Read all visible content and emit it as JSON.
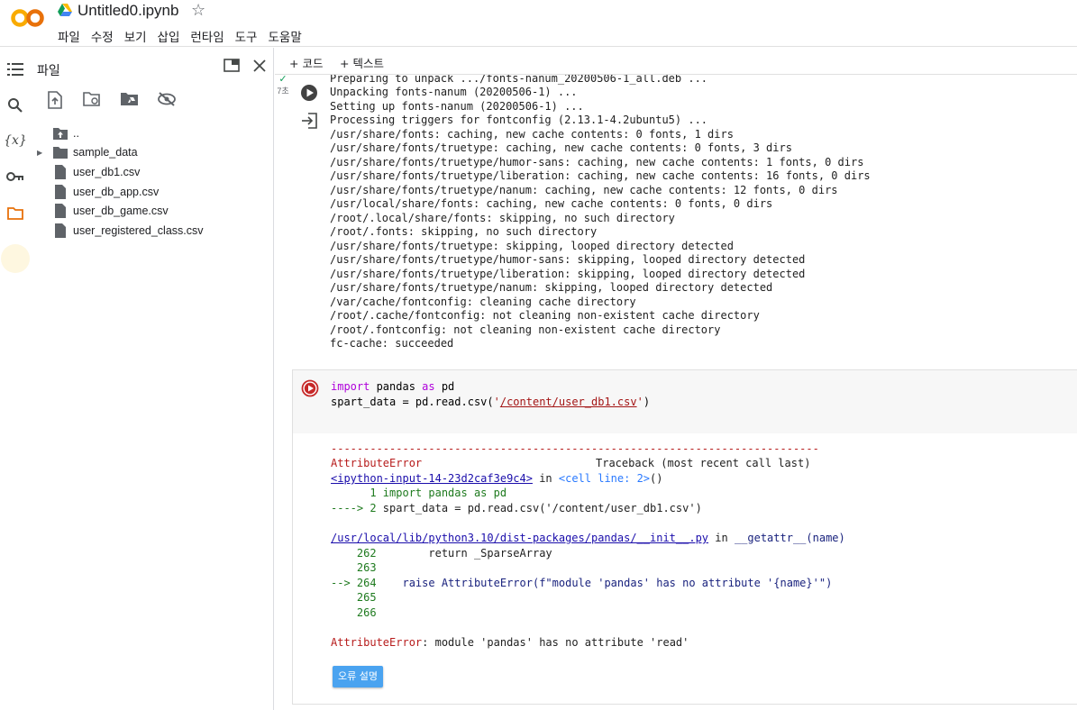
{
  "header": {
    "title": "Untitled0.ipynb",
    "menu": [
      "파일",
      "수정",
      "보기",
      "삽입",
      "런타임",
      "도구",
      "도움말"
    ]
  },
  "colors": {
    "logo_orange": "#f9ab00",
    "logo_dark_orange": "#e8710a",
    "run_red": "#c62828",
    "button_blue": "#4aa3f0"
  },
  "sidebar": {
    "rail_icons": [
      "table-of-contents-icon",
      "search-icon",
      "variables-icon",
      "secrets-key-icon",
      "folder-icon"
    ],
    "panel_title": "파일",
    "toolbar_icons": [
      "upload-file-icon",
      "refresh-icon",
      "mount-drive-icon",
      "hide-files-icon"
    ],
    "tree": [
      {
        "label": "..",
        "type": "parent-folder"
      },
      {
        "label": "sample_data",
        "type": "folder"
      },
      {
        "label": "user_db1.csv",
        "type": "file"
      },
      {
        "label": "user_db_app.csv",
        "type": "file"
      },
      {
        "label": "user_db_game.csv",
        "type": "file"
      },
      {
        "label": "user_registered_class.csv",
        "type": "file"
      }
    ]
  },
  "toolbar": {
    "add_code": "+ 코드",
    "add_text": "+ 텍스트"
  },
  "cell1": {
    "status": "7초",
    "output": [
      "Preparing to unpack .../fonts-nanum_20200506-1_all.deb ...",
      "Unpacking fonts-nanum (20200506-1) ...",
      "Setting up fonts-nanum (20200506-1) ...",
      "Processing triggers for fontconfig (2.13.1-4.2ubuntu5) ...",
      "/usr/share/fonts: caching, new cache contents: 0 fonts, 1 dirs",
      "/usr/share/fonts/truetype: caching, new cache contents: 0 fonts, 3 dirs",
      "/usr/share/fonts/truetype/humor-sans: caching, new cache contents: 1 fonts, 0 dirs",
      "/usr/share/fonts/truetype/liberation: caching, new cache contents: 16 fonts, 0 dirs",
      "/usr/share/fonts/truetype/nanum: caching, new cache contents: 12 fonts, 0 dirs",
      "/usr/local/share/fonts: caching, new cache contents: 0 fonts, 0 dirs",
      "/root/.local/share/fonts: skipping, no such directory",
      "/root/.fonts: skipping, no such directory",
      "/usr/share/fonts/truetype: skipping, looped directory detected",
      "/usr/share/fonts/truetype/humor-sans: skipping, looped directory detected",
      "/usr/share/fonts/truetype/liberation: skipping, looped directory detected",
      "/usr/share/fonts/truetype/nanum: skipping, looped directory detected",
      "/var/cache/fontconfig: cleaning cache directory",
      "/root/.cache/fontconfig: not cleaning non-existent cache directory",
      "/root/.fontconfig: not cleaning non-existent cache directory",
      "fc-cache: succeeded"
    ]
  },
  "cell2": {
    "code": {
      "l1_kw1": "import",
      "l1_mod": " pandas ",
      "l1_kw2": "as",
      "l1_alias": " pd",
      "l2_pre": "spart_data = pd.read.csv(",
      "l2_q1": "'",
      "l2_path": "/content/user_db1.csv",
      "l2_q2": "'",
      "l2_post": ")"
    },
    "error": {
      "dashes": "---------------------------------------------------------------------------",
      "type": "AttributeError",
      "traceback_label": "Traceback (most recent call last)",
      "input_link": "<ipython-input-14-23d2caf3e9c4>",
      "in_word": " in ",
      "cell_ref": "<cell line: 2>",
      "cell_ref_tail": "()",
      "ctx1": "      1 import pandas as pd",
      "ctx2_arrow": "----> 2 ",
      "ctx2_code": "spart_data = pd.read.csv('/content/user_db1.csv')",
      "file_link": "/usr/local/lib/python3.10/dist-packages/pandas/__init__.py",
      "in_word2": " in ",
      "func": "__getattr__(name)",
      "ln262": "    262",
      "ln262_code": "        return _SparseArray",
      "ln263": "    263",
      "ln264_arrow": "--> 264",
      "ln264_code": "    raise AttributeError(f\"module 'pandas' has no attribute '{name}'\")",
      "ln265": "    265",
      "ln266": "    266",
      "final_type": "AttributeError",
      "final_msg": ": module 'pandas' has no attribute 'read'"
    },
    "explain_button": "오류 설명"
  }
}
